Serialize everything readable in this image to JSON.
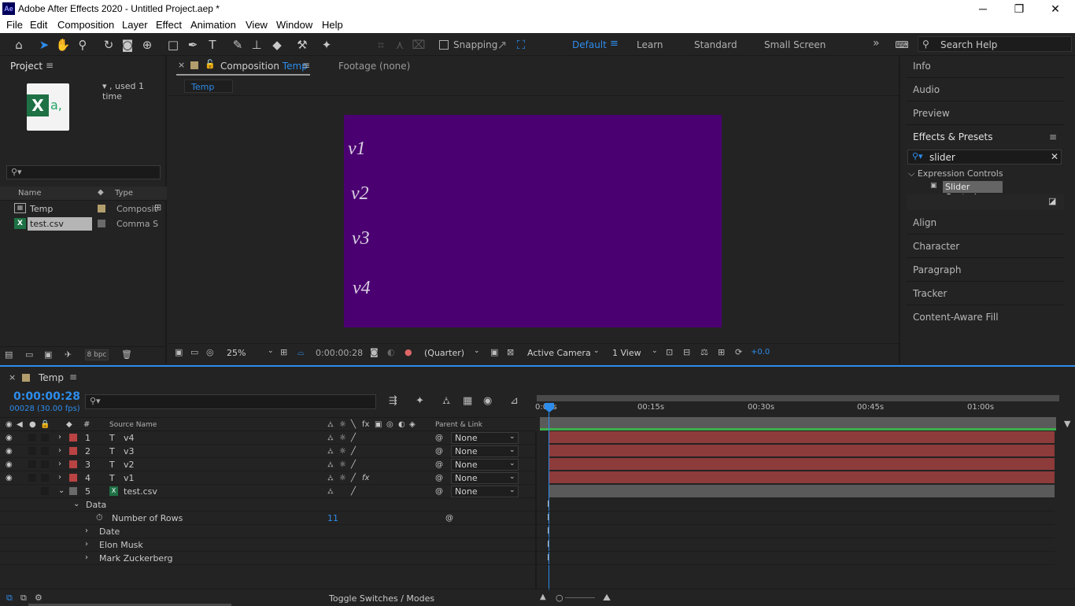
{
  "titlebar": {
    "icon": "Ae",
    "title": "Adobe After Effects 2020 - Untitled Project.aep *",
    "minimize": "─",
    "restore": "❐",
    "close": "✕"
  },
  "menu": [
    "File",
    "Edit",
    "Composition",
    "Layer",
    "Effect",
    "Animation",
    "View",
    "Window",
    "Help"
  ],
  "toolbar": {
    "snapping_label": "Snapping",
    "workspaces": [
      "Default",
      "Learn",
      "Standard",
      "Small Screen"
    ],
    "active_workspace": "Default",
    "more": "»",
    "search_placeholder": "Search Help"
  },
  "project": {
    "tab": "Project",
    "used_text": "▾ , used 1 time",
    "search_placeholder": "",
    "col_name": "Name",
    "col_type": "Type",
    "items": [
      {
        "name": "Temp",
        "type": "Composit"
      },
      {
        "name": "test.csv",
        "type": "Comma S"
      }
    ],
    "bpc": "8 bpc"
  },
  "composition": {
    "tab_prefix": "Composition",
    "tab_name": "Temp",
    "footage_tab": "Footage  (none)",
    "breadcrumb": "Temp",
    "canvas_color": "#4b0072",
    "canvas_texts": [
      "v1",
      "v2",
      "v3",
      "v4"
    ],
    "zoom": "25%",
    "timecode": "0:00:00:28",
    "resolution": "(Quarter)",
    "camera": "Active Camera",
    "views": "1 View",
    "exposure": "+0.0"
  },
  "right_panel": {
    "top_items": [
      "Info",
      "Audio",
      "Preview"
    ],
    "effects_title": "Effects & Presets",
    "effects_search": "slider",
    "category": "Expression Controls",
    "effect_item": "Slider Control",
    "bottom_items": [
      "Align",
      "Character",
      "Paragraph",
      "Tracker",
      "Content-Aware Fill"
    ]
  },
  "timeline": {
    "tab": "Temp",
    "timecode": "0:00:00:28",
    "frames": "00028 (30.00 fps)",
    "col_source": "Source Name",
    "col_parent": "Parent & Link",
    "ruler": [
      "0:00s",
      "00:15s",
      "00:30s",
      "00:45s",
      "01:00s"
    ],
    "layers": [
      {
        "num": "1",
        "type": "T",
        "name": "v4",
        "parent": "None"
      },
      {
        "num": "2",
        "type": "T",
        "name": "v3",
        "parent": "None"
      },
      {
        "num": "3",
        "type": "T",
        "name": "v2",
        "parent": "None"
      },
      {
        "num": "4",
        "type": "T",
        "name": "v1",
        "parent": "None"
      },
      {
        "num": "5",
        "type": "csv",
        "name": "test.csv",
        "parent": "None"
      }
    ],
    "data_group": "Data",
    "number_of_rows_label": "Number of Rows",
    "number_of_rows_value": "11",
    "sub_items": [
      "Date",
      "Elon Musk",
      "Mark Zuckerberg"
    ],
    "toggle_label": "Toggle Switches / Modes",
    "bar_color": "#8e3b3b",
    "accent": "#2d8ceb"
  }
}
